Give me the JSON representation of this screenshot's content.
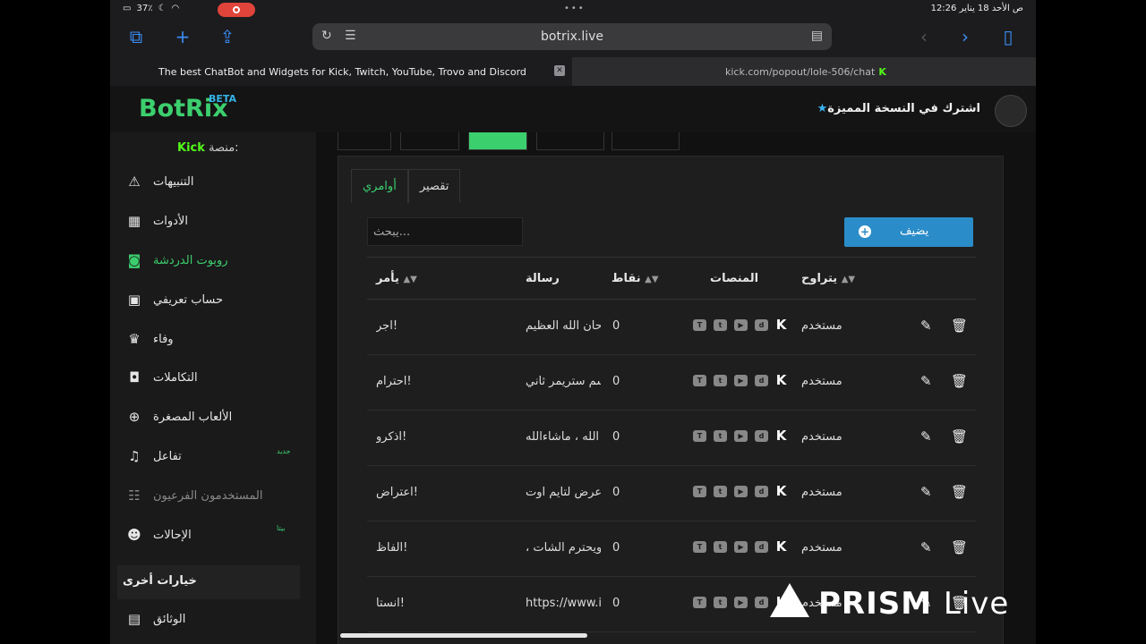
{
  "status_bar": {
    "left_text": "37٪",
    "time_date": "12:26 ص   الأحد 18 يناير",
    "dots": "•••"
  },
  "browser": {
    "url": "botrix.live",
    "tabs": [
      {
        "label": "The best ChatBot and Widgets for Kick, Twitch, YouTube, Trovo and Discord",
        "active": true
      },
      {
        "label": "kick.com/popout/lole-506/chat",
        "active": false
      }
    ]
  },
  "header": {
    "logo": "BotRix",
    "logo_badge": "BETA",
    "premium_link": "اشترك في النسخة المميزة",
    "accent": "#3ccf6e"
  },
  "sidebar": {
    "platform_label": "منصة:",
    "platform_name": "Kick",
    "items": [
      {
        "label": "التنبيهات",
        "icon": "warning-icon"
      },
      {
        "label": "الأدوات",
        "icon": "widgets-icon"
      },
      {
        "label": "روبوت الدردشة",
        "icon": "robot-icon",
        "active": true
      },
      {
        "label": "حساب تعريفي",
        "icon": "id-card-icon"
      },
      {
        "label": "وفاء",
        "icon": "trophy-icon"
      },
      {
        "label": "التكاملات",
        "icon": "integrations-icon"
      },
      {
        "label": "الألعاب المصغرة",
        "icon": "gamepad-icon"
      },
      {
        "label": "تفاعل",
        "icon": "music-icon",
        "badge": "جديد"
      },
      {
        "label": "المستخدمون الفرعيون",
        "icon": "users-icon",
        "dim": true
      },
      {
        "label": "الإحالات",
        "icon": "referrals-icon",
        "badge": "بيتا"
      }
    ],
    "other_options": "خيارات أخرى",
    "docs": "الوثائق"
  },
  "main": {
    "sub_tabs": [
      "أوامري",
      "تقصير"
    ],
    "search_placeholder": "يبحث...",
    "add_button": "يضيف",
    "columns": {
      "command": "يأمر",
      "message": "رسالة",
      "points": "نقاط",
      "platforms": "المنصات",
      "level": "يتراوح"
    },
    "rows": [
      {
        "command": "اجر!",
        "message": "حان الله العظيم",
        "points": "0",
        "level": "مستخدم"
      },
      {
        "command": "احترام!",
        "message": "سم ستريمر ثاني",
        "points": "0",
        "level": "مستخدم"
      },
      {
        "command": "اذكرو!",
        "message": "ع الله ، ماشاءالله",
        "points": "0",
        "level": "مستخدم"
      },
      {
        "command": "اعتراض!",
        "message": "عرض لتايم اوت",
        "points": "0",
        "level": "مستخدم"
      },
      {
        "command": "الفاظ!",
        "message": "، ويحترم الشات",
        "points": "0",
        "level": "مستخدم"
      },
      {
        "command": "انستا!",
        "message": "https://www.i",
        "points": "0",
        "level": "مستخدم"
      }
    ]
  },
  "overlay": {
    "watermark": "PRISM",
    "watermark_suffix": "Live"
  }
}
